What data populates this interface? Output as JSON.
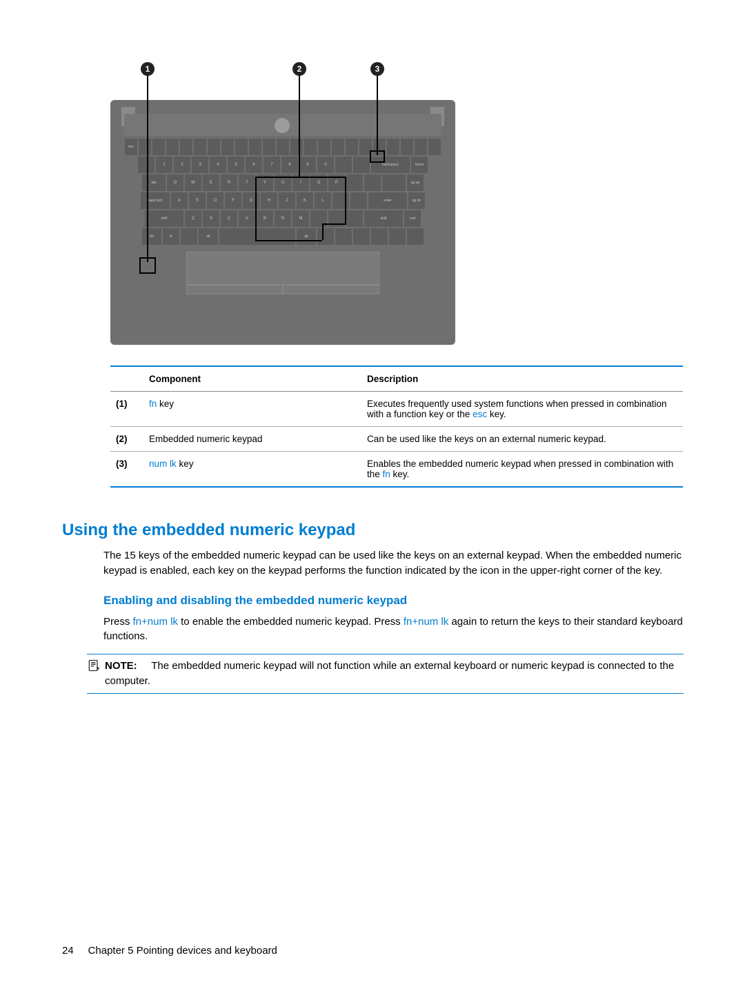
{
  "figure": {
    "callouts": [
      "1",
      "2",
      "3"
    ]
  },
  "table": {
    "headers": {
      "component": "Component",
      "description": "Description"
    },
    "rows": [
      {
        "num": "(1)",
        "comp_link": "fn",
        "comp_text": " key",
        "desc_pre": "Executes frequently used system functions when pressed in combination with a function key or the ",
        "desc_link": "esc",
        "desc_post": " key."
      },
      {
        "num": "(2)",
        "comp_link": "",
        "comp_text": "Embedded numeric keypad",
        "desc_pre": "Can be used like the keys on an external numeric keypad.",
        "desc_link": "",
        "desc_post": ""
      },
      {
        "num": "(3)",
        "comp_link": "num lk",
        "comp_text": " key",
        "desc_pre": "Enables the embedded numeric keypad when pressed in combination with the ",
        "desc_link": "fn",
        "desc_post": " key."
      }
    ]
  },
  "section1": {
    "title": "Using the embedded numeric keypad",
    "para": "The 15 keys of the embedded numeric keypad can be used like the keys on an external keypad. When the embedded numeric keypad is enabled, each key on the keypad performs the function indicated by the icon in the upper-right corner of the key."
  },
  "section2": {
    "title": "Enabling and disabling the embedded numeric keypad",
    "para_pre": "Press ",
    "para_link1": "fn+num lk",
    "para_mid1": " to enable the embedded numeric keypad. Press ",
    "para_link2": "fn+num lk",
    "para_mid2": " again to return the keys to their standard keyboard functions."
  },
  "note": {
    "label": "NOTE:",
    "text": "The embedded numeric keypad will not function while an external keyboard or numeric keypad is connected to the computer."
  },
  "footer": {
    "page": "24",
    "chapter": "Chapter 5   Pointing devices and keyboard"
  }
}
